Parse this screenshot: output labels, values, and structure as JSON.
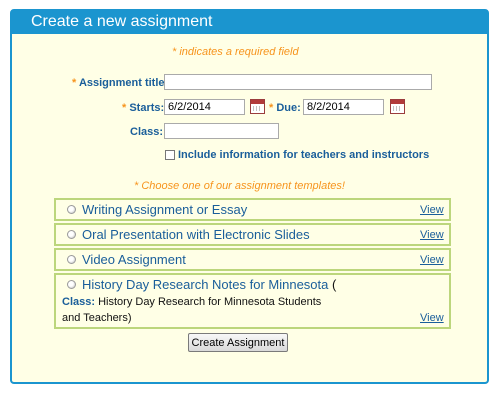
{
  "header": {
    "title": "Create a new assignment"
  },
  "required_note": "indicates a required field",
  "required_mark": "*",
  "form": {
    "title_label": "Assignment title:",
    "title_value": "",
    "starts_label": "Starts:",
    "starts_value": "6/2/2014",
    "due_label": "Due:",
    "due_value": "8/2/2014",
    "class_label": "Class:",
    "class_value": "",
    "include_label": "Include information for teachers and instructors",
    "include_checked": false
  },
  "templates_note": "* Choose one of our assignment templates!",
  "templates": [
    {
      "title": "Writing Assignment or Essay",
      "view": "View"
    },
    {
      "title": "Oral Presentation with Electronic Slides",
      "view": "View"
    },
    {
      "title": "Video Assignment",
      "view": "View"
    },
    {
      "title": "History Day Research Notes for Minnesota",
      "suffix": "(",
      "class_label": "Class:",
      "class_text": "History Day Research for Minnesota Students",
      "class_text2": "and Teachers)",
      "view": "View"
    }
  ],
  "submit_label": "Create Assignment",
  "colors": {
    "header": "#1b95cf",
    "panel_bg": "#ffffe6",
    "required": "#f7941d",
    "label": "#1a5e9a",
    "template_border": "#bcd67c"
  }
}
